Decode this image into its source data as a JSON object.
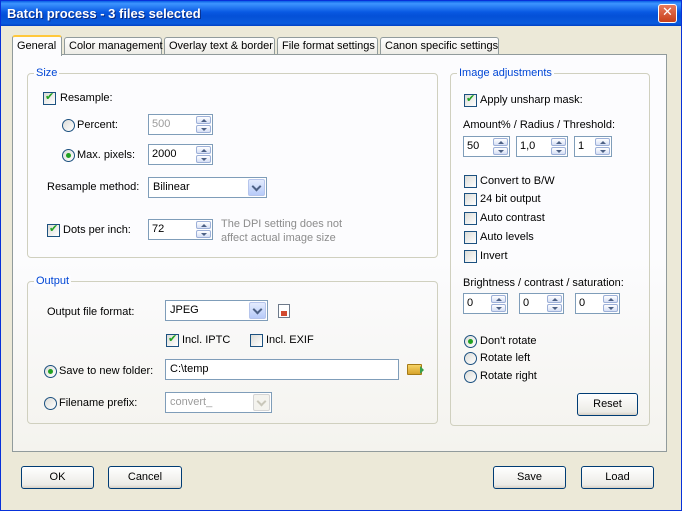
{
  "window": {
    "title": "Batch process - 3 files selected",
    "close_symbol": "✕"
  },
  "tabs": [
    "General",
    "Color management",
    "Overlay text & border",
    "File format settings",
    "Canon specific settings"
  ],
  "size": {
    "title": "Size",
    "resample_label": "Resample:",
    "percent_label": "Percent:",
    "percent_value": "500",
    "max_pixels_label": "Max. pixels:",
    "max_pixels_value": "2000",
    "method_label": "Resample method:",
    "method_value": "Bilinear",
    "dpi_label": "Dots per inch:",
    "dpi_value": "72",
    "dpi_hint_1": "The DPI setting does not",
    "dpi_hint_2": "affect actual image size"
  },
  "output": {
    "title": "Output",
    "format_label": "Output file format:",
    "format_value": "JPEG",
    "iptc_label": "Incl. IPTC",
    "exif_label": "Incl. EXIF",
    "save_folder_label": "Save to new folder:",
    "folder_value": "C:\\temp",
    "prefix_label": "Filename prefix:",
    "prefix_value": "convert_"
  },
  "adjustments": {
    "title": "Image adjustments",
    "unsharp_label": "Apply unsharp mask:",
    "unsharp_params_label": "Amount% / Radius / Threshold:",
    "amount": "50",
    "radius": "1,0",
    "threshold": "1",
    "bw_label": "Convert to B/W",
    "bit24_label": "24 bit output",
    "autocontrast_label": "Auto contrast",
    "autolevels_label": "Auto levels",
    "invert_label": "Invert",
    "bcs_label": "Brightness / contrast / saturation:",
    "brightness": "0",
    "contrast": "0",
    "saturation": "0",
    "dont_rotate_label": "Don't rotate",
    "rotate_left_label": "Rotate left",
    "rotate_right_label": "Rotate right",
    "reset_label": "Reset"
  },
  "footer": {
    "ok": "OK",
    "cancel": "Cancel",
    "save": "Save",
    "load": "Load"
  }
}
